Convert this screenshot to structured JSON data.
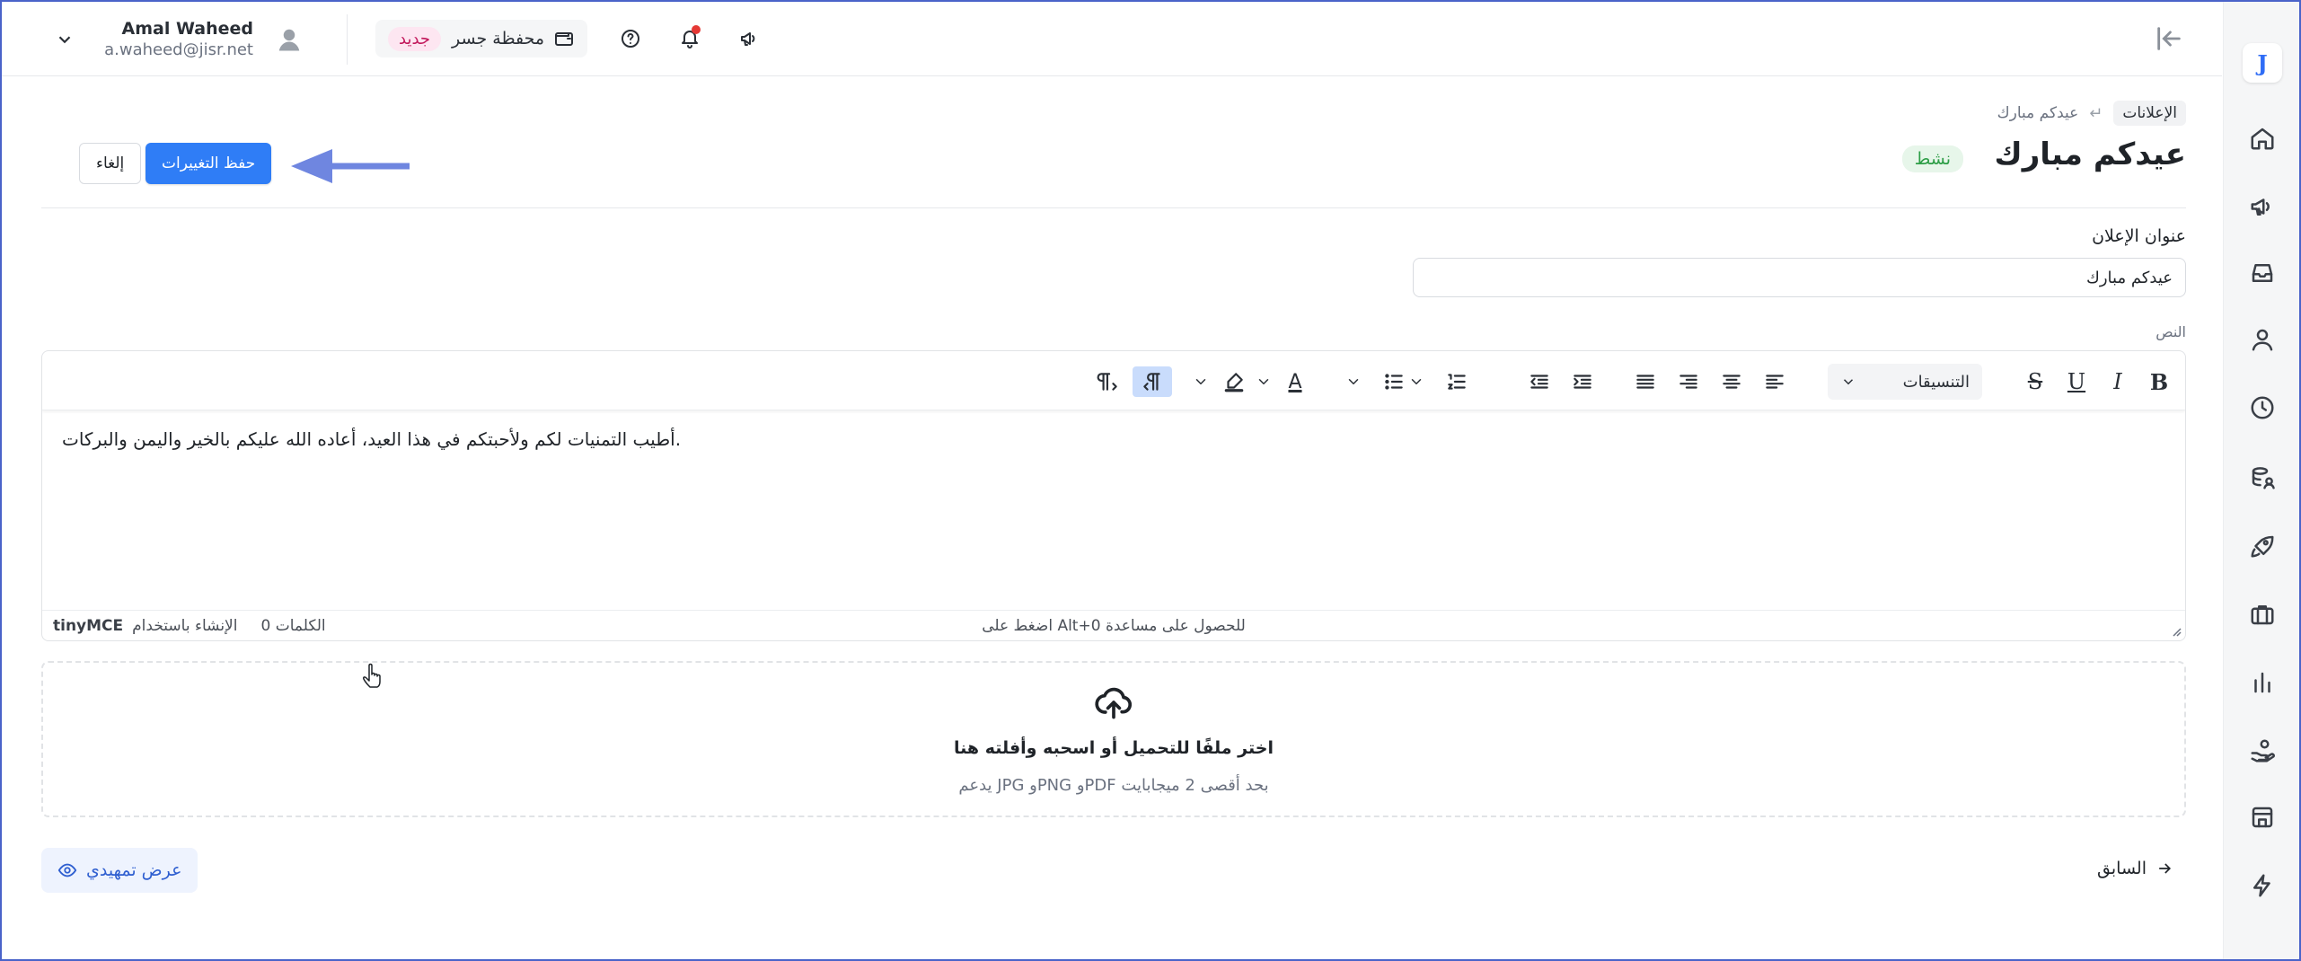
{
  "topbar": {
    "user_name": "Amal Waheed",
    "user_email": "a.waheed@jisr.net",
    "wallet_label": "محفظة جسر",
    "new_badge": "جديد"
  },
  "breadcrumb": {
    "parent": "الإعلانات",
    "separator": "↵",
    "current": "عيدكم مبارك"
  },
  "page": {
    "title": "عيدكم مبارك",
    "status": "نشط",
    "save_label": "حفظ التغييرات",
    "cancel_label": "إلغاء"
  },
  "form": {
    "title_label": "عنوان الإعلان",
    "title_value": "عيدكم مبارك",
    "body_label": "النص"
  },
  "editor": {
    "format_select": "التنسيقات",
    "content": "أطيب التمنيات لكم ولأحبتكم في هذا العيد، أعاده الله عليكم بالخير واليمن والبركات.",
    "help_hint": "اضغط على Alt+0 للحصول على مساعدة",
    "word_count": "0 الكلمات",
    "built_with": "الإنشاء باستخدام",
    "brand": "tinyMCE",
    "toolbar_letters": {
      "bold": "B",
      "italic": "I",
      "underline": "U",
      "strike": "S",
      "text_color": "A"
    }
  },
  "upload": {
    "title": "اختر ملفًا للتحميل أو اسحبه وأفلته هنا",
    "hint": "يدعم JPG وPNG وPDF بحد أقصى 2 ميجابايت"
  },
  "footer": {
    "preview_label": "عرض تمهيدي",
    "previous_label": "السابق"
  },
  "rail": {
    "logo": "J"
  },
  "colors": {
    "primary": "#2f7df6",
    "active_badge": "#2e9e47",
    "new_badge": "#c2185b",
    "annotation_arrow": "#6f86e0"
  }
}
